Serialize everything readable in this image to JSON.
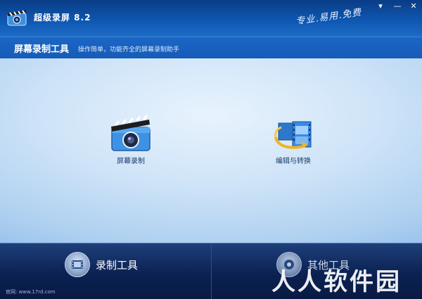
{
  "window": {
    "title": "超级录屏 8.2",
    "slogan": "专业.易用.免费",
    "controls": {
      "menu": "▾",
      "minimize": "—",
      "close": "✕"
    }
  },
  "header": {
    "title": "屏幕录制工具",
    "description": "操作简单，功能齐全的屏幕录制助手"
  },
  "tools": [
    {
      "label": "屏幕录制",
      "icon": "clapperboard-camera-icon"
    },
    {
      "label": "编辑与转换",
      "icon": "film-strip-convert-icon"
    }
  ],
  "bottom_tabs": [
    {
      "label": "录制工具",
      "icon": "film-icon"
    },
    {
      "label": "其他工具",
      "icon": "tools-icon"
    }
  ],
  "footer": {
    "text": "官网: www.17rd.com"
  },
  "watermark": "人人软件园",
  "colors": {
    "titlebar": "#0f59b4",
    "bottom": "#0b2152",
    "accent": "#1b66c4"
  }
}
